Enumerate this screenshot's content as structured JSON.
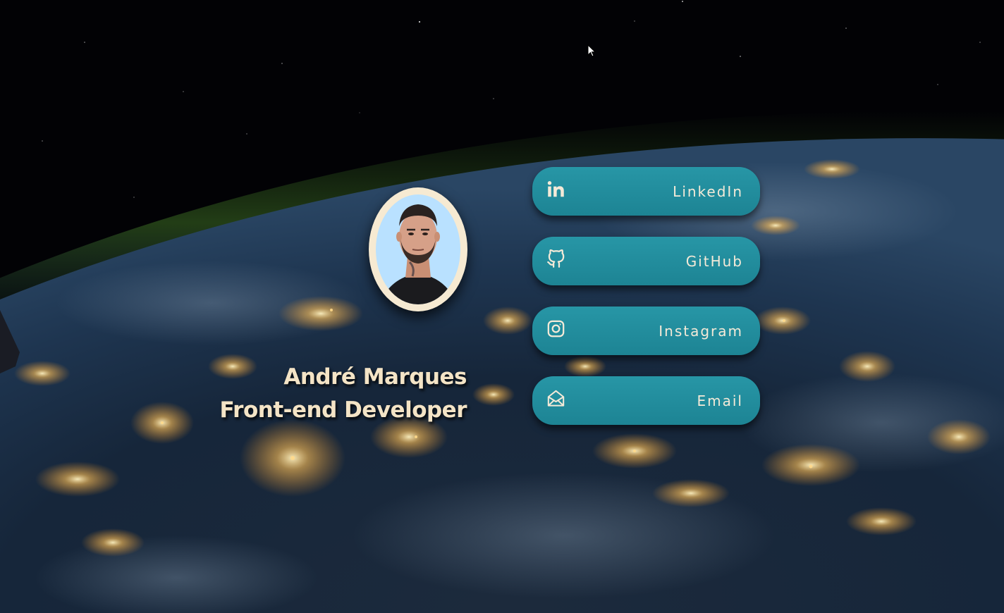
{
  "profile": {
    "name": "André Marques",
    "role": "Front-end Developer"
  },
  "links": [
    {
      "label": "LinkedIn",
      "icon": "linkedin-icon"
    },
    {
      "label": "GitHub",
      "icon": "github-icon"
    },
    {
      "label": "Instagram",
      "icon": "instagram-icon"
    },
    {
      "label": "Email",
      "icon": "email-icon"
    }
  ],
  "colors": {
    "button": "#2390a0",
    "text_accent": "#f4e4c6",
    "avatar_frame": "#f6ead2",
    "avatar_background": "#b9e1ff"
  }
}
